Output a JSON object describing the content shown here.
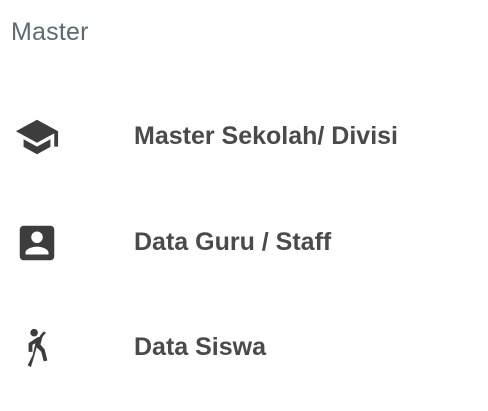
{
  "section": {
    "title": "Master"
  },
  "menu": {
    "items": [
      {
        "label": "Master Sekolah/ Divisi",
        "icon": "graduation-cap-icon"
      },
      {
        "label": "Data Guru / Staff",
        "icon": "account-box-icon"
      },
      {
        "label": "Data Siswa",
        "icon": "student-figure-icon"
      }
    ]
  },
  "colors": {
    "header_text": "#5c6b73",
    "item_text": "#4a4a4a",
    "icon": "#3d3d3d",
    "background": "#ffffff"
  }
}
